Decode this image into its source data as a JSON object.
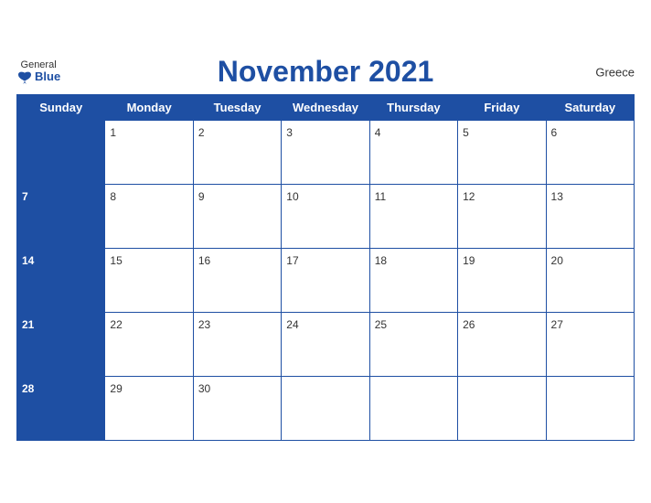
{
  "header": {
    "title": "November 2021",
    "country": "Greece",
    "logo_general": "General",
    "logo_blue": "Blue"
  },
  "weekdays": [
    "Sunday",
    "Monday",
    "Tuesday",
    "Wednesday",
    "Thursday",
    "Friday",
    "Saturday"
  ],
  "weeks": [
    [
      null,
      1,
      2,
      3,
      4,
      5,
      6
    ],
    [
      7,
      8,
      9,
      10,
      11,
      12,
      13
    ],
    [
      14,
      15,
      16,
      17,
      18,
      19,
      20
    ],
    [
      21,
      22,
      23,
      24,
      25,
      26,
      27
    ],
    [
      28,
      29,
      30,
      null,
      null,
      null,
      null
    ]
  ],
  "colors": {
    "blue": "#1e4fa3",
    "white": "#ffffff",
    "text": "#333333"
  }
}
